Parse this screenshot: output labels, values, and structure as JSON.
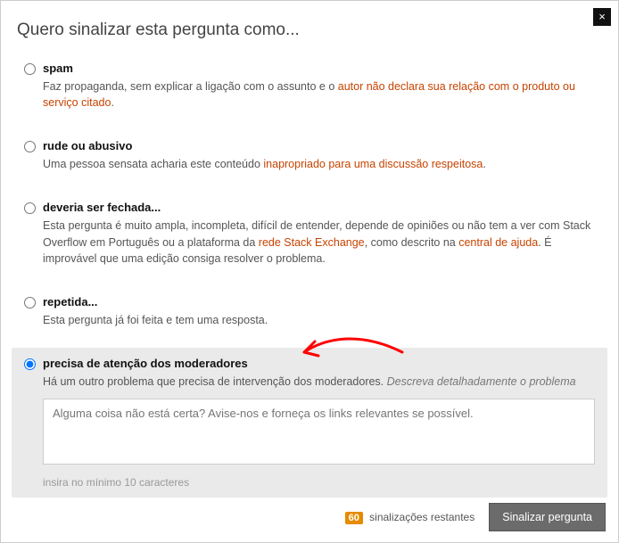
{
  "title": "Quero sinalizar esta pergunta como...",
  "close": "×",
  "options": [
    {
      "id": "spam",
      "title": "spam",
      "desc_parts": [
        {
          "t": "Faz propaganda, sem explicar a ligação com o assunto e o "
        },
        {
          "t": "autor não declara sua relação com o produto ou serviço citado",
          "link": true
        },
        {
          "t": "."
        }
      ],
      "selected": false
    },
    {
      "id": "rude",
      "title": "rude ou abusivo",
      "desc_parts": [
        {
          "t": "Uma pessoa sensata acharia este conteúdo "
        },
        {
          "t": "inapropriado para uma discussão respeitosa",
          "link": true
        },
        {
          "t": "."
        }
      ],
      "selected": false
    },
    {
      "id": "close",
      "title": "deveria ser fechada...",
      "desc_parts": [
        {
          "t": "Esta pergunta é muito ampla, incompleta, difícil de entender, depende de opiniões ou não tem a ver com Stack Overflow em Português ou a plataforma da "
        },
        {
          "t": "rede Stack Exchange",
          "link": true
        },
        {
          "t": ", como descrito na "
        },
        {
          "t": "central de ajuda",
          "link": true
        },
        {
          "t": ". É improvável que uma edição consiga resolver o problema."
        }
      ],
      "selected": false
    },
    {
      "id": "dup",
      "title": "repetida...",
      "desc_parts": [
        {
          "t": "Esta pergunta já foi feita e tem uma resposta."
        }
      ],
      "selected": false
    },
    {
      "id": "mod",
      "title": "precisa de atenção dos moderadores",
      "desc_parts": [
        {
          "t": "Há um outro problema que precisa de intervenção dos moderadores. "
        },
        {
          "t": "Descreva detalhadamente o problema",
          "em": true
        }
      ],
      "selected": true,
      "textarea_placeholder": "Alguma coisa não está certa? Avise-nos e forneça os links relevantes se possível.",
      "hint": "insira no mínimo 10 caracteres"
    }
  ],
  "footer": {
    "count": "60",
    "remaining_label": "sinalizações restantes",
    "submit_label": "Sinalizar pergunta"
  }
}
